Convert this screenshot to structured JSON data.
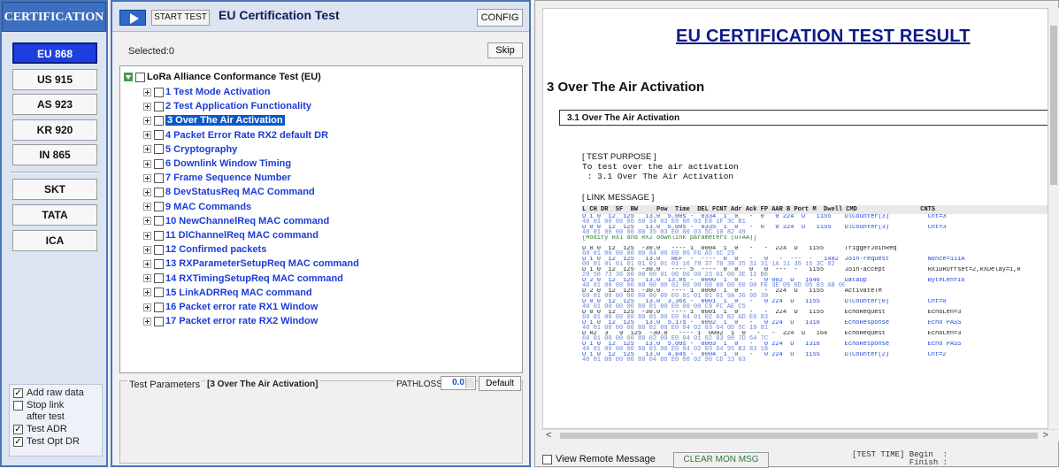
{
  "sidebar": {
    "title": "CERTIFICATION",
    "regions": [
      "EU 868",
      "US 915",
      "AS 923",
      "KR 920",
      "IN 865"
    ],
    "operators": [
      "SKT",
      "TATA",
      "ICA"
    ],
    "options": [
      {
        "label": "Add raw data",
        "checked": true
      },
      {
        "label": "Stop link after test",
        "checked": false
      },
      {
        "label": "Test ADR",
        "checked": true
      },
      {
        "label": "Test Opt DR",
        "checked": true
      }
    ]
  },
  "middle": {
    "start_label": "START TEST",
    "title": "EU Certification Test",
    "config_label": "CONFIG",
    "selected_text": "Selected:0",
    "skip_label": "Skip",
    "tree_root": "LoRa Alliance Conformance Test (EU)",
    "tree_items": [
      "1 Test Mode Activation",
      "2 Test Application Functionality",
      "3 Over The Air Activation",
      "4 Packet Error Rate RX2 default DR",
      "5 Cryptography",
      "6 Downlink Window Timing",
      "7 Frame Sequence Number",
      "8 DevStatusReq MAC Command",
      "9 MAC Commands",
      "10 NewChannelReq MAC command",
      "11 DlChannelReq MAC command",
      "12 Confirmed packets",
      "13 RXParameterSetupReq MAC command",
      "14 RXTimingSetupReq MAC command",
      "15 LinkADRReq MAC command",
      "16 Packet error rate RX1 Window",
      "17 Packet error rate RX2 Window"
    ],
    "params_label": "Test Parameters",
    "params_value": "[3 Over The Air Activation]",
    "pathloss_label": "PATHLOSS",
    "pathloss_value": "0.0",
    "default_label": "Default"
  },
  "report": {
    "title": "EU CERTIFICATION TEST RESULT",
    "section": "3 Over The Air Activation",
    "subsection": "3.1 Over The Air Activation",
    "purpose_header": "[ TEST PURPOSE ]",
    "purpose_line1": "To test over the air activation",
    "purpose_line2": " : 3.1 Over The Air Activation",
    "link_header": "[ LINK MESSAGE ]",
    "log_header": "L CH DR  SF  BW     Pow  Time  DEL FCNT Adr Ack FP AAR B Port M  Dwell CMD                 CNTS",
    "log_rows": [
      {
        "main": "U 1 0  12  125   13.0  5.00s -  0334  1  0   -  0   0 224  U   1155",
        "cmd": "DlCounter(3)",
        "cnts": "Cnt=3",
        "hex": "40 01 00 00 00 60 34 03 E0 00 03 E8 1F 3C B1",
        "color": "blue"
      },
      {
        "main": "U 0 0  12  125   13.0  5.00s -  0335  1  0   -  0   0 224  U   1155",
        "cmd": "DlCounter(3)",
        "cnts": "Cnt=3",
        "hex": "40 01 00 00 00 80 35 03 E0 00 03 5C 10 82 49",
        "color": "blue"
      },
      {
        "main": "[Modify RX1 and RX2 downlink parameters (OTAA)]",
        "cmd": "",
        "cnts": "",
        "hex": "",
        "color": "green"
      },
      {
        "main": "D 0 0  12  125  -30.0   ---- 1  0004  1  0   -   -  224  U   1155",
        "cmd": "TriggerJoinReq",
        "cnts": "",
        "hex": "60 01 00 00 00 80 04 00 E0 06 F6 A5 6C 29",
        "color": "dark"
      },
      {
        "main": "U 1 0  12  125   13.0   REF  -  ----  0  0   -   0   -  ---  -   1482",
        "cmd": "Join-request",
        "cnts": "Nonce=111A",
        "hex": "00 01 01 01 01 01 01 01 01 16 78 37 70 38 35 31 31 1A 11 35 15 3C 82",
        "color": "blue"
      },
      {
        "main": "D 1 0  12  125  -30.0   ---- 5  ----  0  0   0   0  ---  -   1155",
        "cmd": "Join-accept",
        "cnts": "RX1DROffset=2,RXDelay=1,R",
        "hex": "20 58 73 36 00 00 00 01 00 00 00 23 01 00 3E 11 B6",
        "color": "dark"
      },
      {
        "main": "U 2 0  12  125   13.0  13.8s -  0000  1  0   -   0 002  U   1646",
        "cmd": "DataUp",
        "cnts": "ByteLen=16",
        "hex": "40 01 00 00 00 80 00 00 02 00 00 00 00 00 00 00 FE 3E 09 0D 05 03 AB 00 00 DE 5C 1C 0F",
        "color": "blue"
      },
      {
        "main": "D 2 0  12  125  -30.0   ---- 1  0000  1  0   -   -  224  U   1155",
        "cmd": "ActivateTM",
        "cnts": "",
        "hex": "60 01 00 00 00 80 00 00 E0 01 01 01 01 9A 36 9D 39",
        "color": "dark"
      },
      {
        "main": "U 0 0  12  125   13.0  3.36s -  0001  1  0   -   0 224  U   1155",
        "cmd": "DlCounter(0)",
        "cnts": "Cnt=0",
        "hex": "40 01 00 00 00 80 01 00 E0 00 00 C9 FC AE C5",
        "color": "blue"
      },
      {
        "main": "D 0 0  12  125  -30.0   ---- 1  0001  1  0   -   -  224  U   1155",
        "cmd": "EchoRequest",
        "cnts": "EchoLen=3",
        "hex": "60 01 00 00 00 80 01 00 E0 04 01 02 03 B2 AD E6 83",
        "color": "dark"
      },
      {
        "main": "U 1 0  12  125   13.0  5.17s -  0002  1  0   -   0 224  U   1318",
        "cmd": "EchoResponse",
        "cnts": "Echo PASS",
        "hex": "40 01 00 00 00 80 02 00 E0 04 02 03 04 0D 5C 19 81",
        "color": "blue"
      },
      {
        "main": "D R2  3   9  125  -30.0   ---- 1  0002  1  0   -   -  224  U   164",
        "cmd": "EchoRequest",
        "cnts": "EchoLen=3",
        "hex": "60 01 00 00 00 80 02 00 E0 04 01 02 03 98 7D 64 7C",
        "color": "dark"
      },
      {
        "main": "U 1 0  12  125   13.0  5.00s -  0003  1  0   -   0 224  U   1318",
        "cmd": "EchoResponse",
        "cnts": "Echo PASS",
        "hex": "40 01 00 00 00 80 03 00 E0 04 02 03 04 95 B3 83 18",
        "color": "blue"
      },
      {
        "main": "U 1 0  12  125   13.0  4.84s -  0004  1  0   -   0 224  U   1155",
        "cmd": "DlCounter(2)",
        "cnts": "Cnt=2",
        "hex": "40 01 00 00 00 80 04 00 E0 00 02 90 CD 13 03",
        "color": "blue"
      }
    ],
    "view_remote_label": "View Remote Message",
    "clear_label": "CLEAR MON MSG",
    "test_time": "[TEST TIME] Begin  :\n            Finish :"
  }
}
